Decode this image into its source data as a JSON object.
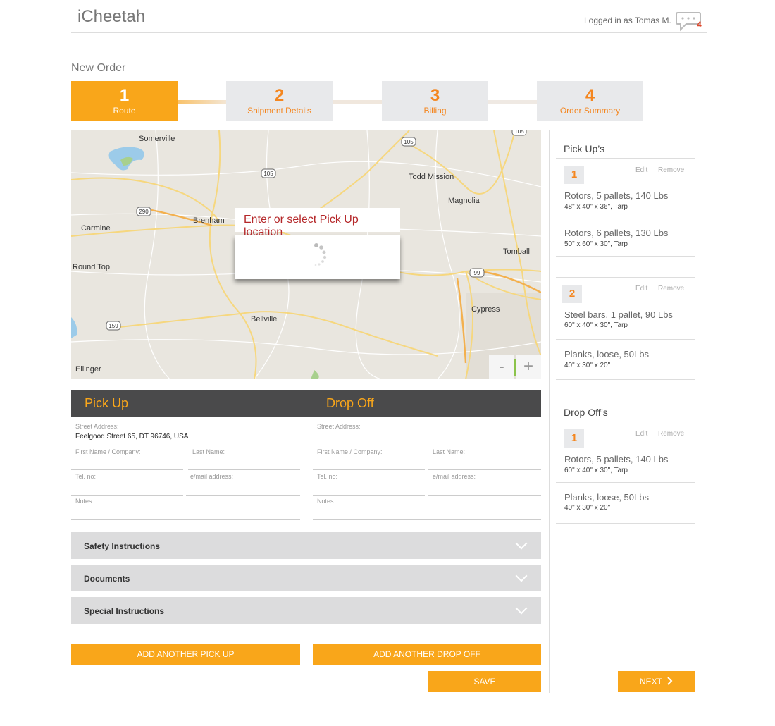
{
  "header": {
    "app_title": "iCheetah",
    "login_text": "Logged in as Tomas M.",
    "message_count": "4"
  },
  "page": {
    "title": "New Order"
  },
  "steps": [
    {
      "number": "1",
      "label": "Route"
    },
    {
      "number": "2",
      "label": "Shipment Details"
    },
    {
      "number": "3",
      "label": "Billing"
    },
    {
      "number": "4",
      "label": "Order Summary"
    }
  ],
  "map": {
    "tooltip_prefix": "Enter or select ",
    "tooltip_bold": "Pick Up",
    "tooltip_suffix": " location",
    "places": [
      "Somerville",
      "Brenham",
      "Carmine",
      "Round Top",
      "Bellville",
      "Ellinger",
      "Todd Mission",
      "Magnolia",
      "Tomball",
      "Cypress"
    ],
    "road_shields": [
      "105",
      "105",
      "105",
      "290",
      "290",
      "99",
      "159"
    ],
    "zoom_out": "-",
    "zoom_in": "+"
  },
  "form": {
    "pickup_title": "Pick Up",
    "dropoff_title": "Drop Off",
    "labels": {
      "street": "Street Address:",
      "first_name": "First Name / Company:",
      "last_name": "Last Name:",
      "tel": "Tel. no:",
      "email": "e/mail address:",
      "notes": "Notes:"
    },
    "pickup_street_value": "Feelgood Street 65, DT 96746, USA"
  },
  "accordions": [
    "Safety Instructions",
    "Documents",
    "Special Instructions"
  ],
  "buttons": {
    "add_pickup": "ADD ANOTHER PICK UP",
    "add_dropoff": "ADD ANOTHER DROP OFF",
    "save": "SAVE",
    "next": "NEXT"
  },
  "panel": {
    "pickups_title": "Pick Up’s",
    "dropoffs_title": "Drop Off’s",
    "edit": "Edit",
    "remove": "Remove",
    "pickups": [
      {
        "badge": "1",
        "items": [
          {
            "title": "Rotors, 5 pallets, 140 Lbs",
            "sub": "48\" x 40\" x 36\", Tarp"
          },
          {
            "title": "Rotors, 6 pallets, 130 Lbs",
            "sub": "50\" x 60\" x 30\", Tarp"
          }
        ]
      },
      {
        "badge": "2",
        "items": [
          {
            "title": "Steel bars, 1 pallet, 90 Lbs",
            "sub": "60\" x 40\" x 30\", Tarp"
          },
          {
            "title": "Planks, loose, 50Lbs",
            "sub": "40\" x 30\" x 20\""
          }
        ]
      }
    ],
    "dropoffs": [
      {
        "badge": "1",
        "items": [
          {
            "title": "Rotors, 5 pallets, 140 Lbs",
            "sub": "60\" x 40\" x 30\", Tarp"
          },
          {
            "title": "Planks, loose, 50Lbs",
            "sub": "40\" x 30\" x 20\""
          }
        ]
      }
    ]
  },
  "colors": {
    "accent": "#f9a61a",
    "accent_text": "#f4861f",
    "dark_header": "#4a4a4b",
    "tooltip_red": "#b5282a"
  }
}
